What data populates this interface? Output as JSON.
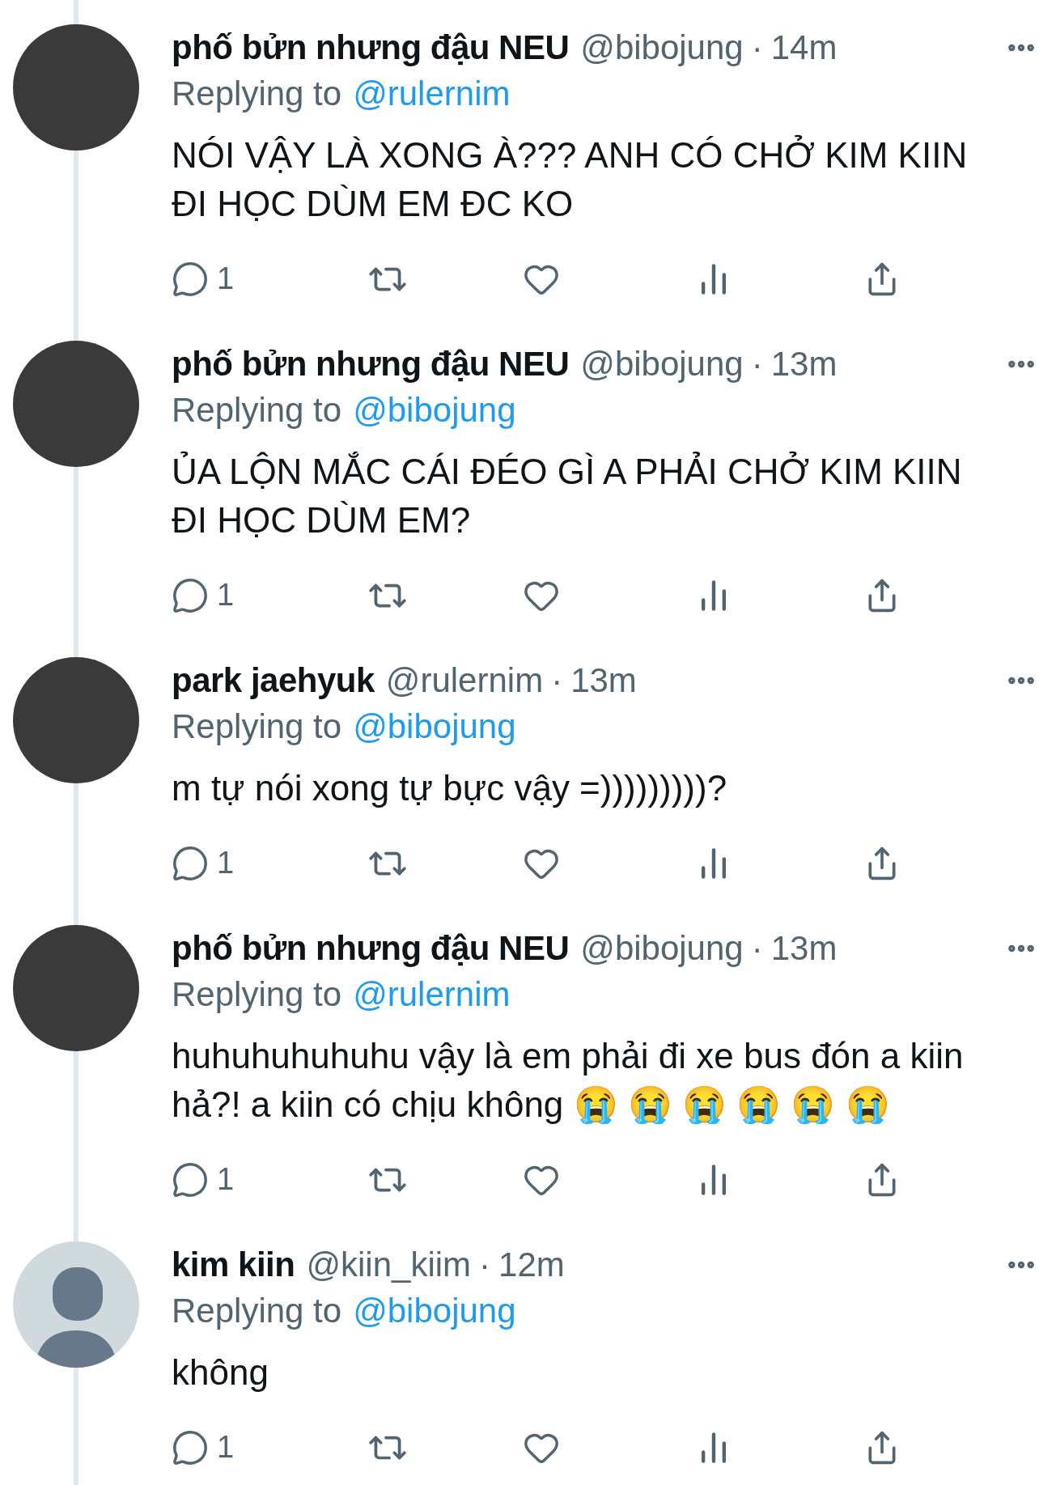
{
  "tweets": [
    {
      "avatar": {
        "kind": "photo"
      },
      "name": "phố bửn nhưng đậu NEU",
      "handle": "@bibojung",
      "separator": "·",
      "time": "14m",
      "replying_label": "Replying to",
      "replying_to": "@rulernim",
      "body": "NÓI VẬY LÀ XONG À??? ANH CÓ CHỞ KIM KIIN ĐI HỌC DÙM EM ĐC KO",
      "replies": "1"
    },
    {
      "avatar": {
        "kind": "photo"
      },
      "name": "phố bửn nhưng đậu NEU",
      "handle": "@bibojung",
      "separator": "·",
      "time": "13m",
      "replying_label": "Replying to",
      "replying_to": "@bibojung",
      "body": "ỦA LỘN MẮC CÁI ĐÉO GÌ A PHẢI CHỞ KIM KIIN ĐI HỌC DÙM EM?",
      "replies": "1"
    },
    {
      "avatar": {
        "kind": "photo"
      },
      "name": "park jaehyuk",
      "handle": "@rulernim",
      "separator": "·",
      "time": "13m",
      "replying_label": "Replying to",
      "replying_to": "@bibojung",
      "body": "m tự nói xong tự bực vậy =)))))))))?",
      "replies": "1"
    },
    {
      "avatar": {
        "kind": "photo"
      },
      "name": "phố bửn nhưng đậu NEU",
      "handle": "@bibojung",
      "separator": "·",
      "time": "13m",
      "replying_label": "Replying to",
      "replying_to": "@rulernim",
      "body": "huhuhuhuhuhu vậy là em phải đi xe bus đón a kiin hả?! a kiin có chịu không 😭 😭 😭 😭 😭 😭",
      "replies": "1"
    },
    {
      "avatar": {
        "kind": "default"
      },
      "name": "kim kiin",
      "handle": "@kiin_kiim",
      "separator": "·",
      "time": "12m",
      "replying_label": "Replying to",
      "replying_to": "@bibojung",
      "body": "không",
      "replies": "1"
    }
  ]
}
